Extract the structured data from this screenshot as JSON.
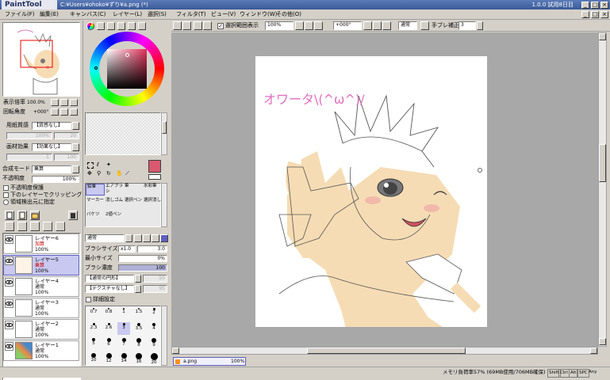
{
  "titlebar": {
    "logo": "PaintTool SAI",
    "title": "C:¥Users¥ohoko¥ずり¥a.png (*)",
    "version": "1.0.0 試用8日目"
  },
  "menu": [
    "ファイル(F)",
    "編集(E)",
    "キャンバス(C)",
    "レイヤー(L)",
    "選択(S)",
    "フィルタ(T)",
    "ビュー(V)",
    "ウィンドウ(W)",
    "その他(O)"
  ],
  "nav": {
    "zoom_label": "表示倍率",
    "zoom_value": "100.0%",
    "angle_label": "回転角度",
    "angle_value": "+000°"
  },
  "paper": {
    "texture_label": "用紙質感",
    "texture_value": "【質感なし】",
    "texture_scale": "100%",
    "texture_strength": "20",
    "effect_label": "画材効果",
    "effect_value": "【効果なし】",
    "effect_width": "1",
    "effect_strength": "100"
  },
  "layerprops": {
    "blend_label": "合成モード",
    "blend_value": "乗算",
    "opacity_label": "不透明度",
    "opacity_value": "100%",
    "protect": "不透明度保護",
    "clip": "下のレイヤーでクリッピング",
    "select_src": "領域検出元に指定"
  },
  "layers": [
    {
      "name": "レイヤー6",
      "mode": "加算",
      "opacity": "100%"
    },
    {
      "name": "レイヤー5",
      "mode": "乗算",
      "opacity": "100%"
    },
    {
      "name": "レイヤー4",
      "mode": "通常",
      "opacity": "100%"
    },
    {
      "name": "レイヤー3",
      "mode": "通常",
      "opacity": "100%"
    },
    {
      "name": "レイヤー2",
      "mode": "通常",
      "opacity": "100%"
    },
    {
      "name": "レイヤー1",
      "mode": "通常",
      "opacity": "100%"
    }
  ],
  "tools": [
    {
      "label": "鉛筆"
    },
    {
      "label": "エアブラシ"
    },
    {
      "label": "筆"
    },
    {
      "label": "水彩筆"
    },
    {
      "label": "マーカー"
    },
    {
      "label": "消しゴム"
    },
    {
      "label": "選択ペン"
    },
    {
      "label": "選択消し"
    },
    {
      "label": "バケツ"
    },
    {
      "label": "2値ペン"
    }
  ],
  "brush": {
    "mode": "通常",
    "size_label": "ブラシサイズ",
    "size_mult": "x1.0",
    "size_value": "3.0",
    "minsize_label": "最小サイズ",
    "minsize_value": "0%",
    "density_label": "ブラシ濃度",
    "density_value": "100",
    "shape": "【通常の円形】",
    "shape_val": "50",
    "texture": "【テクスチャなし】",
    "texture_val": "95",
    "detail": "詳細設定"
  },
  "brushsizes": [
    "0.7",
    "0.8",
    "1",
    "1.5",
    "2",
    "2.3",
    "2.6",
    "3",
    "3.5",
    "4",
    "5",
    "6",
    "7",
    "8",
    "9",
    "10",
    "12",
    "14",
    "16",
    "20"
  ],
  "toolbar": {
    "show_selection": "選択範囲表示",
    "zoom": "100%",
    "angle": "+000°",
    "mode": "通常",
    "stabilizer_label": "手ブレ補正",
    "stabilizer_value": "3"
  },
  "canvas_text": "オワータ\\(^ω^)/",
  "doctab": {
    "name": "a.png",
    "zoom": "100%"
  },
  "status": {
    "memory": "メモリ負荷率57% (69MB使用/706MB確保)",
    "keys": [
      "Shift",
      "Ctrl",
      "Alt",
      "SPC"
    ],
    "any": "Any"
  },
  "colors": {
    "accent": "#c8c8f0",
    "swatch": "#d85a70",
    "skin": "#f6dcb4"
  }
}
